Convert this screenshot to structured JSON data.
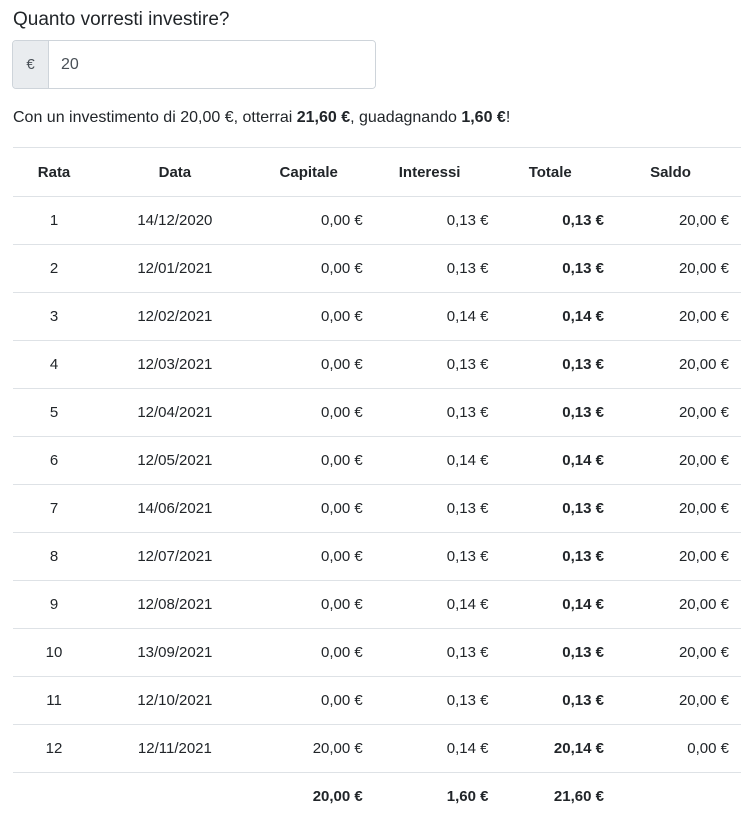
{
  "heading": "Quanto vorresti investire?",
  "input": {
    "prefix": "€",
    "value": "20"
  },
  "summary": {
    "part1": "Con un investimento di 20,00 €, otterrai ",
    "total": "21,60 €",
    "part2": ", guadagnando ",
    "gain": "1,60 €",
    "part3": "!"
  },
  "table": {
    "headers": [
      "Rata",
      "Data",
      "Capitale",
      "Interessi",
      "Totale",
      "Saldo"
    ],
    "rows": [
      [
        "1",
        "14/12/2020",
        "0,00 €",
        "0,13 €",
        "0,13 €",
        "20,00 €"
      ],
      [
        "2",
        "12/01/2021",
        "0,00 €",
        "0,13 €",
        "0,13 €",
        "20,00 €"
      ],
      [
        "3",
        "12/02/2021",
        "0,00 €",
        "0,14 €",
        "0,14 €",
        "20,00 €"
      ],
      [
        "4",
        "12/03/2021",
        "0,00 €",
        "0,13 €",
        "0,13 €",
        "20,00 €"
      ],
      [
        "5",
        "12/04/2021",
        "0,00 €",
        "0,13 €",
        "0,13 €",
        "20,00 €"
      ],
      [
        "6",
        "12/05/2021",
        "0,00 €",
        "0,14 €",
        "0,14 €",
        "20,00 €"
      ],
      [
        "7",
        "14/06/2021",
        "0,00 €",
        "0,13 €",
        "0,13 €",
        "20,00 €"
      ],
      [
        "8",
        "12/07/2021",
        "0,00 €",
        "0,13 €",
        "0,13 €",
        "20,00 €"
      ],
      [
        "9",
        "12/08/2021",
        "0,00 €",
        "0,14 €",
        "0,14 €",
        "20,00 €"
      ],
      [
        "10",
        "13/09/2021",
        "0,00 €",
        "0,13 €",
        "0,13 €",
        "20,00 €"
      ],
      [
        "11",
        "12/10/2021",
        "0,00 €",
        "0,13 €",
        "0,13 €",
        "20,00 €"
      ],
      [
        "12",
        "12/11/2021",
        "20,00 €",
        "0,14 €",
        "20,14 €",
        "0,00 €"
      ]
    ],
    "totals": [
      "",
      "",
      "20,00 €",
      "1,60 €",
      "21,60 €",
      ""
    ]
  }
}
